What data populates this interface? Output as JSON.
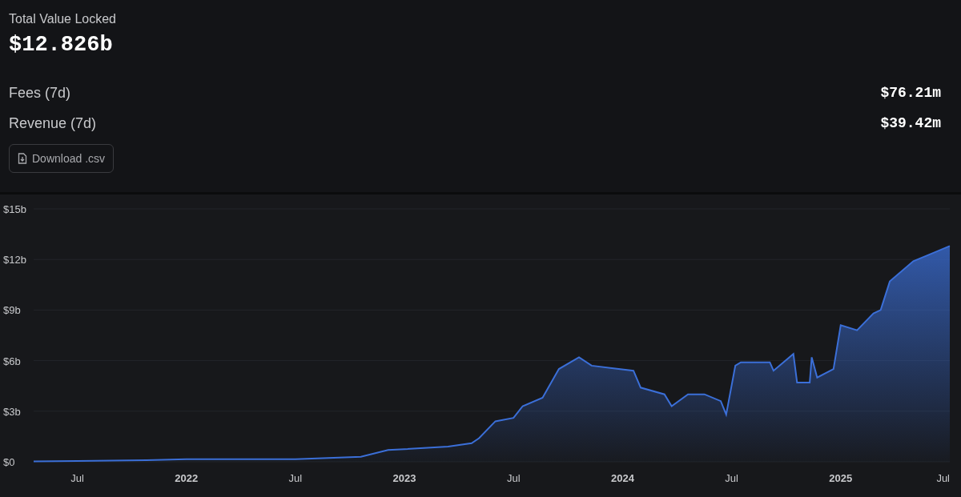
{
  "summary": {
    "tvl_label": "Total Value Locked",
    "tvl_value": "$12.826b",
    "metrics": [
      {
        "label": "Fees (7d)",
        "value": "$76.21m"
      },
      {
        "label": "Revenue (7d)",
        "value": "$39.42m"
      }
    ],
    "download_button": "Download .csv"
  },
  "chart": {
    "chart_data": {
      "type": "area",
      "grid": true,
      "xlim": [
        2021.3,
        2025.5
      ],
      "ylim": [
        0,
        15
      ],
      "xticks": [
        {
          "value": 2021.5,
          "label": "Jul"
        },
        {
          "value": 2022,
          "label": "2022"
        },
        {
          "value": 2022.5,
          "label": "Jul"
        },
        {
          "value": 2023,
          "label": "2023"
        },
        {
          "value": 2023.5,
          "label": "Jul"
        },
        {
          "value": 2024,
          "label": "2024"
        },
        {
          "value": 2024.5,
          "label": "Jul"
        },
        {
          "value": 2025,
          "label": "2025"
        },
        {
          "value": 2025.5,
          "label": "Jul"
        }
      ],
      "yticks": [
        {
          "value": 0,
          "label": "$0"
        },
        {
          "value": 3,
          "label": "$3b"
        },
        {
          "value": 6,
          "label": "$6b"
        },
        {
          "value": 9,
          "label": "$9b"
        },
        {
          "value": 12,
          "label": "$12b"
        },
        {
          "value": 15,
          "label": "$15b"
        }
      ],
      "x": [
        2021.3,
        2021.5,
        2021.817,
        2022,
        2022.5,
        2022.8,
        2022.925,
        2023,
        2023.2,
        2023.308,
        2023.342,
        2023.417,
        2023.5,
        2023.542,
        2023.633,
        2023.708,
        2023.8,
        2023.858,
        2024.05,
        2024.083,
        2024.192,
        2024.225,
        2024.3,
        2024.375,
        2024.45,
        2024.475,
        2024.517,
        2024.542,
        2024.675,
        2024.692,
        2024.783,
        2024.8,
        2024.858,
        2024.867,
        2024.892,
        2024.967,
        2025,
        2025.075,
        2025.15,
        2025.183,
        2025.225,
        2025.333,
        2025.408,
        2025.5
      ],
      "series": [
        {
          "color": "#3b6fd8",
          "values": [
            0.02,
            0.05,
            0.1,
            0.15,
            0.15,
            0.3,
            0.7,
            0.75,
            0.9,
            1.1,
            1.4,
            2.4,
            2.6,
            3.3,
            3.8,
            5.5,
            6.2,
            5.7,
            5.4,
            4.4,
            4.0,
            3.3,
            4.0,
            4.0,
            3.6,
            2.8,
            5.7,
            5.9,
            5.9,
            5.4,
            6.4,
            4.7,
            4.7,
            6.2,
            5.0,
            5.5,
            8.1,
            7.8,
            8.8,
            9.0,
            10.7,
            11.9,
            12.3,
            12.8
          ]
        }
      ]
    }
  }
}
